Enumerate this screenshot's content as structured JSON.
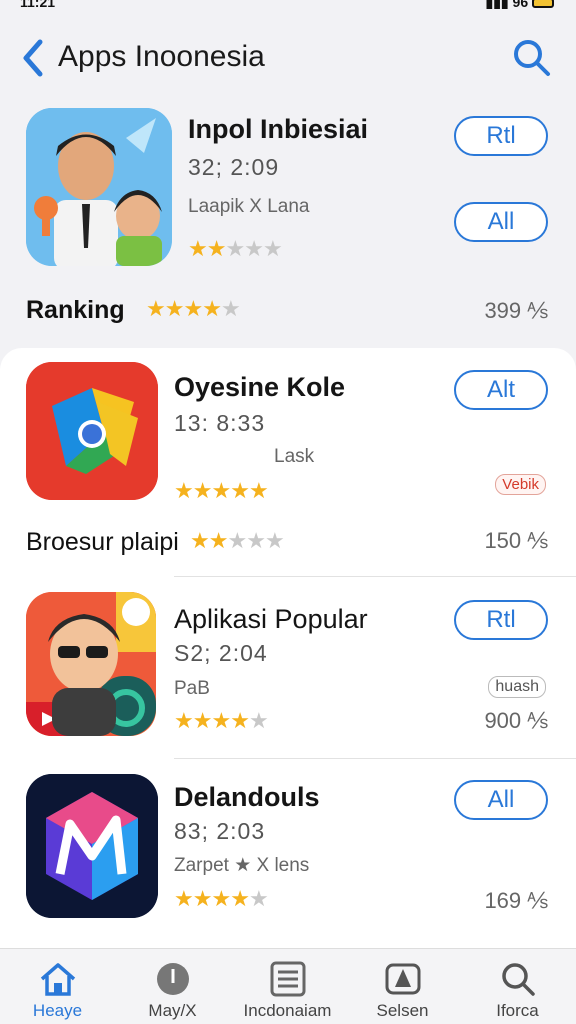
{
  "status": {
    "time": "11:21",
    "right": "96"
  },
  "nav": {
    "title": "Apps Inoonesia"
  },
  "apps": [
    {
      "name": "Inpol Inbiesiai",
      "meta": "32; 2:09",
      "dev": "Laapik X Lana",
      "btn1": "Rtl",
      "btn2": "All",
      "rating": 2,
      "row_label": "Ranking",
      "row_rating": 4,
      "row_count": "399 ⅍"
    },
    {
      "name": "Oyesine Kole",
      "meta": "13: 8:33",
      "dev": "Lask",
      "btn1": "Alt",
      "badge": "Vebik",
      "rating": 5,
      "row_label": "Broesur plaipi",
      "row_rating": 2,
      "row_count": "150 ⅍"
    },
    {
      "name": "Aplikasi Popular",
      "meta": "S2; 2:04",
      "dev": "PaB",
      "btn1": "Rtl",
      "badge": "huash",
      "rating": 4,
      "row_count": "900 ⅍"
    },
    {
      "name": "Delandouls",
      "meta": "83; 2:03",
      "dev": "Zarpet ★ X lens",
      "btn1": "All",
      "rating": 4,
      "row_count": "169 ⅍"
    }
  ],
  "tabs": [
    {
      "label": "Heaye",
      "icon": "home-icon"
    },
    {
      "label": "May/X",
      "icon": "compass-icon"
    },
    {
      "label": "Incdonaiam",
      "icon": "list-icon"
    },
    {
      "label": "Selsen",
      "icon": "apps-icon"
    },
    {
      "label": "Iforca",
      "icon": "search-icon"
    }
  ],
  "colors": {
    "accent": "#2a78d8",
    "star": "#f5b21e"
  }
}
